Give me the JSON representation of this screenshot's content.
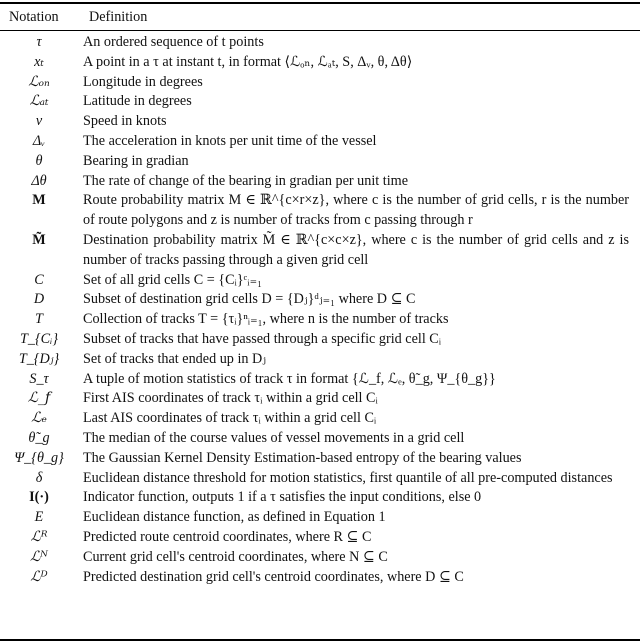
{
  "table": {
    "header": {
      "notation": "Notation",
      "definition": "Definition"
    },
    "rows": [
      {
        "notation": "τ",
        "definition": "An ordered sequence of t points"
      },
      {
        "notation": "xₜ",
        "definition": "A point in a τ at instant t, in format ⟨ℒₒₙ, ℒₐₜ, S, Δᵥ, θ, Δθ⟩"
      },
      {
        "notation": "ℒₒₙ",
        "definition": "Longitude in degrees"
      },
      {
        "notation": "ℒₐₜ",
        "definition": "Latitude in degrees"
      },
      {
        "notation": "v",
        "definition": "Speed in knots"
      },
      {
        "notation": "Δᵥ",
        "definition": "The acceleration in knots per unit time of the vessel"
      },
      {
        "notation": "θ",
        "definition": "Bearing in gradian"
      },
      {
        "notation": "Δθ",
        "definition": "The rate of change of the bearing in gradian per unit time"
      },
      {
        "notation": "M",
        "definition": "Route probability matrix M ∈ ℝ^{c×r×z}, where c is the number of grid cells, r is the number of route polygons and z is number of tracks from c passing through r"
      },
      {
        "notation": "M̃",
        "definition": "Destination probability matrix M̃ ∈ ℝ^{c×c×z}, where c is the number of grid cells and z is number of tracks passing through a given grid cell"
      },
      {
        "notation": "C",
        "definition": "Set of all grid cells C = {Cᵢ}ᶜᵢ₌₁"
      },
      {
        "notation": "D",
        "definition": "Subset of destination grid cells D = {Dⱼ}ᵈⱼ₌₁ where D ⊆ C"
      },
      {
        "notation": "T",
        "definition": "Collection of tracks T = {τᵢ}ⁿᵢ₌₁, where n is the number of tracks"
      },
      {
        "notation": "T_{Cᵢ}",
        "definition": "Subset of tracks that have passed through a specific grid cell Cᵢ"
      },
      {
        "notation": "T_{Dⱼ}",
        "definition": "Set of tracks that ended up in Dⱼ"
      },
      {
        "notation": "S_τ",
        "definition": "A tuple of motion statistics of track τ in format {ℒ_f, ℒₑ, θ̃_g, Ψ_{θ_g}}"
      },
      {
        "notation": "ℒ_f",
        "definition": "First AIS coordinates of track τᵢ within a grid cell Cᵢ"
      },
      {
        "notation": "ℒₑ",
        "definition": "Last AIS coordinates of track τᵢ within a grid cell Cᵢ"
      },
      {
        "notation": "θ̃_g",
        "definition": "The median of the course values of vessel movements in a grid cell"
      },
      {
        "notation": "Ψ_{θ_g}",
        "definition": "The Gaussian Kernel Density Estimation-based entropy of the bearing values"
      },
      {
        "notation": "δ",
        "definition": "Euclidean distance threshold for motion statistics, first quantile of all pre-computed distances"
      },
      {
        "notation": "I(·)",
        "definition": "Indicator function, outputs 1 if a τ satisfies the input conditions, else 0"
      },
      {
        "notation": "E",
        "definition": "Euclidean distance function, as defined in Equation 1"
      },
      {
        "notation": "ℒᴿ",
        "definition": "Predicted route centroid coordinates, where R ⊆ C"
      },
      {
        "notation": "ℒᴺ",
        "definition": "Current grid cell's centroid coordinates, where N ⊆ C"
      },
      {
        "notation": "ℒᴰ",
        "definition": "Predicted destination grid cell's centroid coordinates, where D ⊆ C"
      }
    ]
  }
}
